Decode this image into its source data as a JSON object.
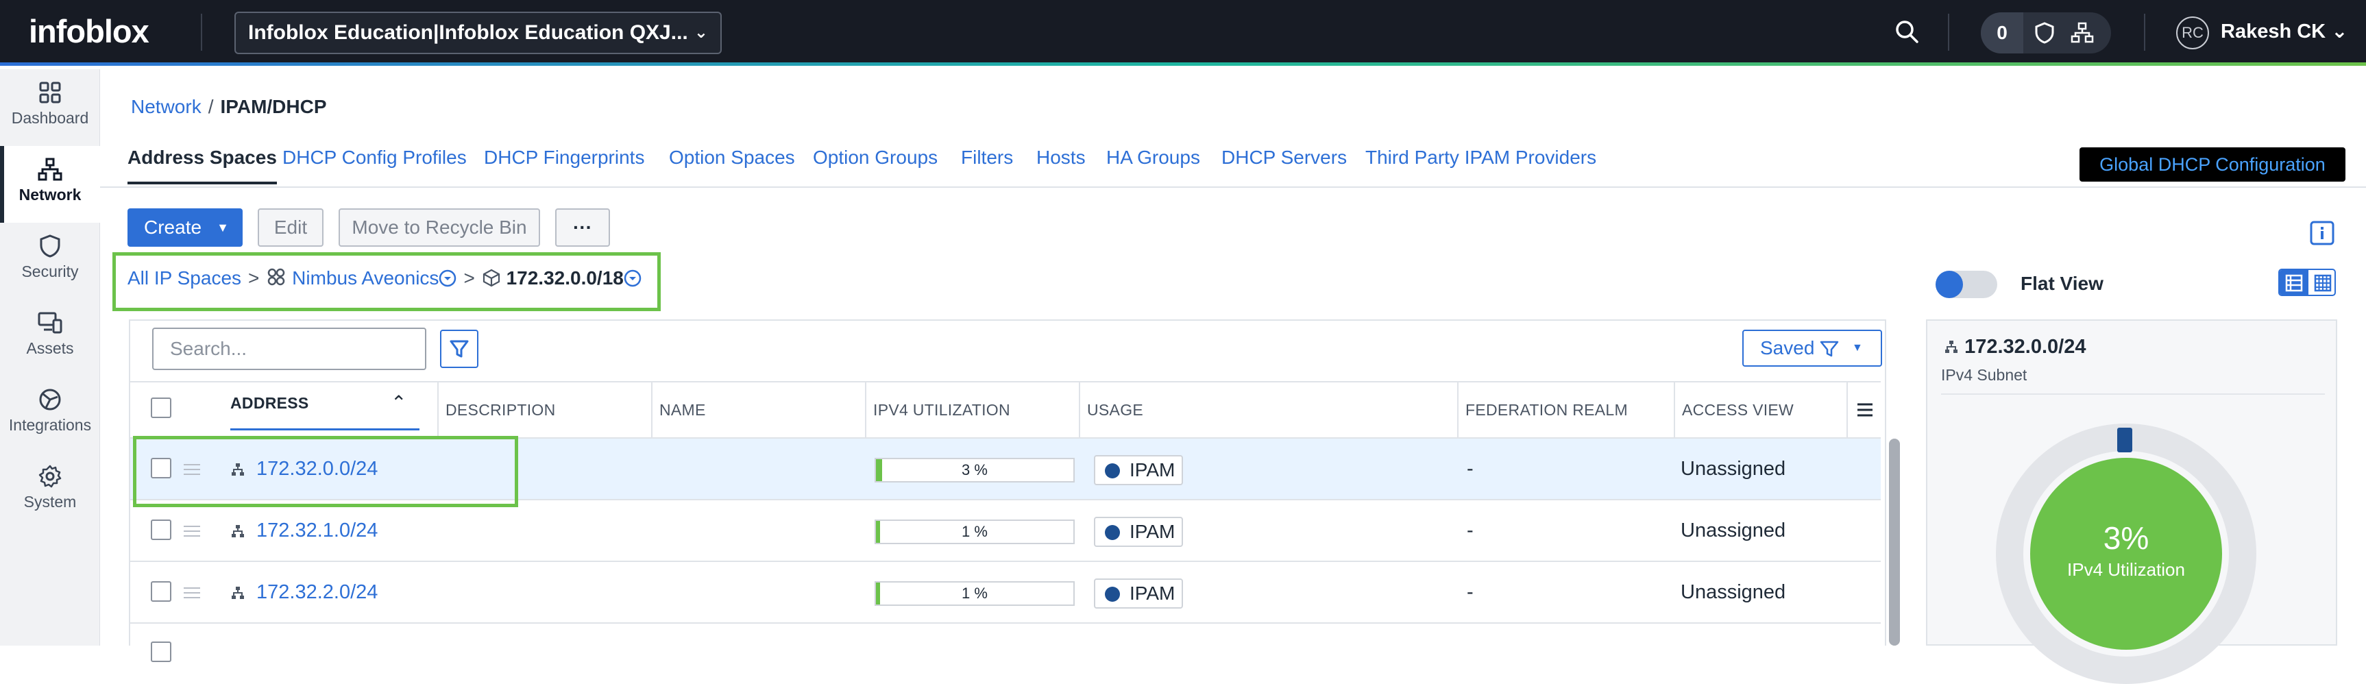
{
  "topbar": {
    "logo": "infoblox",
    "org_selector": "Infoblox Education|Infoblox Education QXJ...",
    "notification_count": "0",
    "avatar_initials": "RC",
    "user_name": "Rakesh CK"
  },
  "leftnav": {
    "items": [
      {
        "label": "Dashboard",
        "icon": "dashboard-icon"
      },
      {
        "label": "Network",
        "icon": "network-icon",
        "active": true
      },
      {
        "label": "Security",
        "icon": "shield-icon"
      },
      {
        "label": "Assets",
        "icon": "assets-icon"
      },
      {
        "label": "Integrations",
        "icon": "integrations-icon"
      },
      {
        "label": "System",
        "icon": "gear-icon"
      }
    ]
  },
  "breadcrumb": {
    "parent": "Network",
    "separator": "/",
    "current": "IPAM/DHCP"
  },
  "tabs": [
    "Address Spaces",
    "DHCP Config Profiles",
    "DHCP Fingerprints",
    "Option Spaces",
    "Option Groups",
    "Filters",
    "Hosts",
    "HA Groups",
    "DHCP Servers",
    "Third Party IPAM Providers"
  ],
  "global_dhcp_button": "Global DHCP Configuration",
  "toolbar": {
    "create": "Create",
    "edit": "Edit",
    "recycle": "Move to Recycle Bin",
    "more": "···"
  },
  "path": {
    "root": "All IP Spaces",
    "space": "Nimbus Aveonics",
    "block": "172.32.0.0/18",
    "sep": ">"
  },
  "flat_view_label": "Flat View",
  "search": {
    "placeholder": "Search..."
  },
  "saved_label": "Saved",
  "columns": {
    "address": "ADDRESS",
    "description": "DESCRIPTION",
    "name": "NAME",
    "utilization": "IPV4 UTILIZATION",
    "usage": "USAGE",
    "federation": "FEDERATION REALM",
    "access": "ACCESS VIEW"
  },
  "rows": [
    {
      "address": "172.32.0.0/24",
      "utilization": "3 %",
      "util_value": 3,
      "usage": "IPAM",
      "federation": "-",
      "access": "Unassigned",
      "selected": true
    },
    {
      "address": "172.32.1.0/24",
      "utilization": "1 %",
      "util_value": 1,
      "usage": "IPAM",
      "federation": "-",
      "access": "Unassigned"
    },
    {
      "address": "172.32.2.0/24",
      "utilization": "1 %",
      "util_value": 1,
      "usage": "IPAM",
      "federation": "-",
      "access": "Unassigned"
    }
  ],
  "detail_card": {
    "title": "172.32.0.0/24",
    "subtitle": "IPv4 Subnet",
    "percent": "3%",
    "percent_label": "IPv4 Utilization",
    "utilization_value": 3
  },
  "colors": {
    "accent": "#2d6fd6",
    "highlight": "#6cc24a",
    "usage_dot": "#1d4f91",
    "topbar": "#171b24"
  }
}
